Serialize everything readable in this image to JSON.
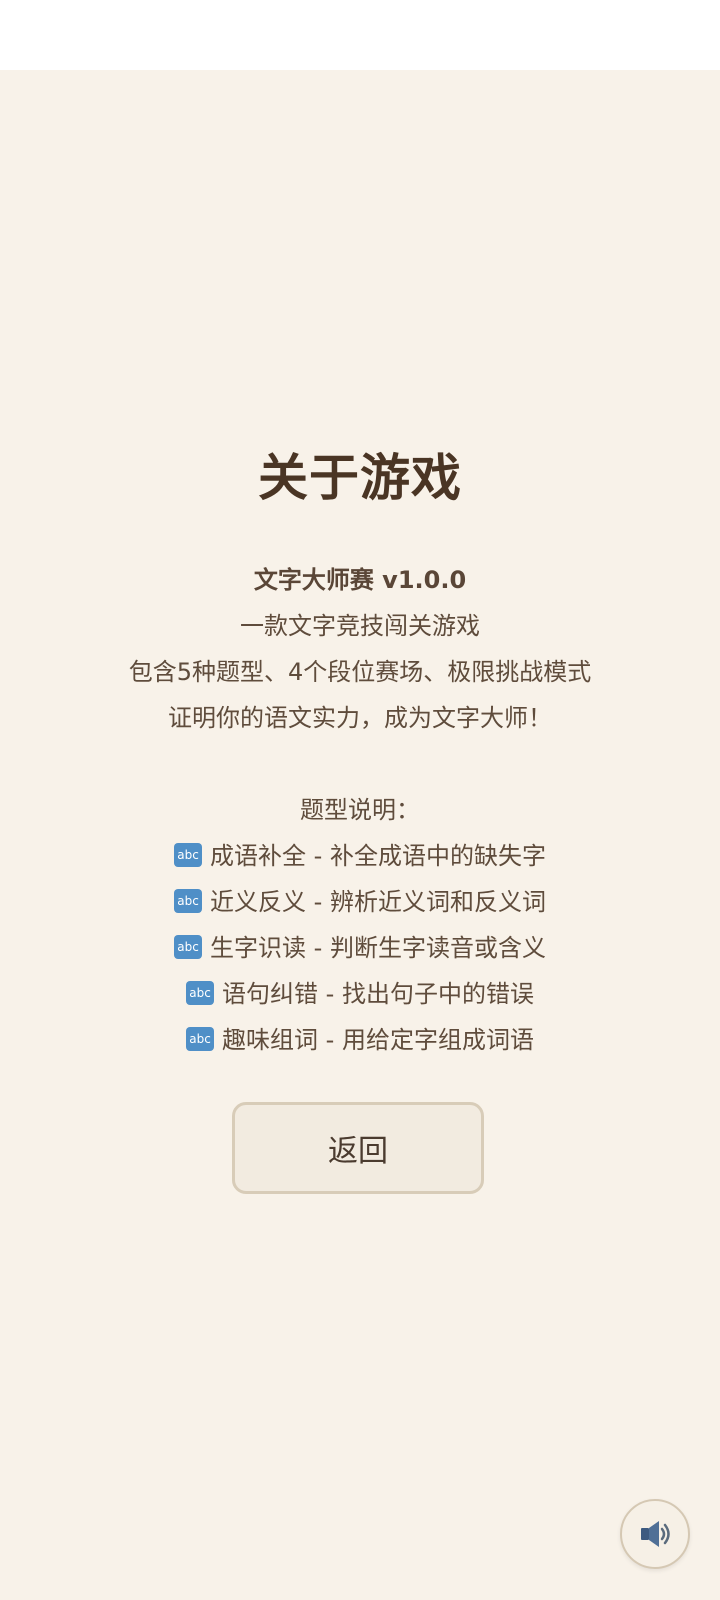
{
  "page": {
    "title": "关于游戏"
  },
  "intro": {
    "version_line": "文字大师赛 v1.0.0",
    "lines": [
      "一款文字竞技闯关游戏",
      "包含5种题型、4个段位赛场、极限挑战模式",
      "证明你的语文实力，成为文字大师！"
    ]
  },
  "types": {
    "header": "题型说明：",
    "badge_text": "abc",
    "items": [
      "成语补全 - 补全成语中的缺失字",
      "近义反义 - 辨析近义词和反义词",
      "生字识读 - 判断生字读音或含义",
      "语句纠错 - 找出句子中的错误",
      "趣味组词 - 用给定字组成词语"
    ]
  },
  "buttons": {
    "back_label": "返回"
  },
  "icons": {
    "sound": "speaker-icon"
  },
  "colors": {
    "background": "#f8f2e9",
    "title": "#4a3524",
    "text": "#5f4c3c",
    "badge": "#4f8fc7"
  }
}
